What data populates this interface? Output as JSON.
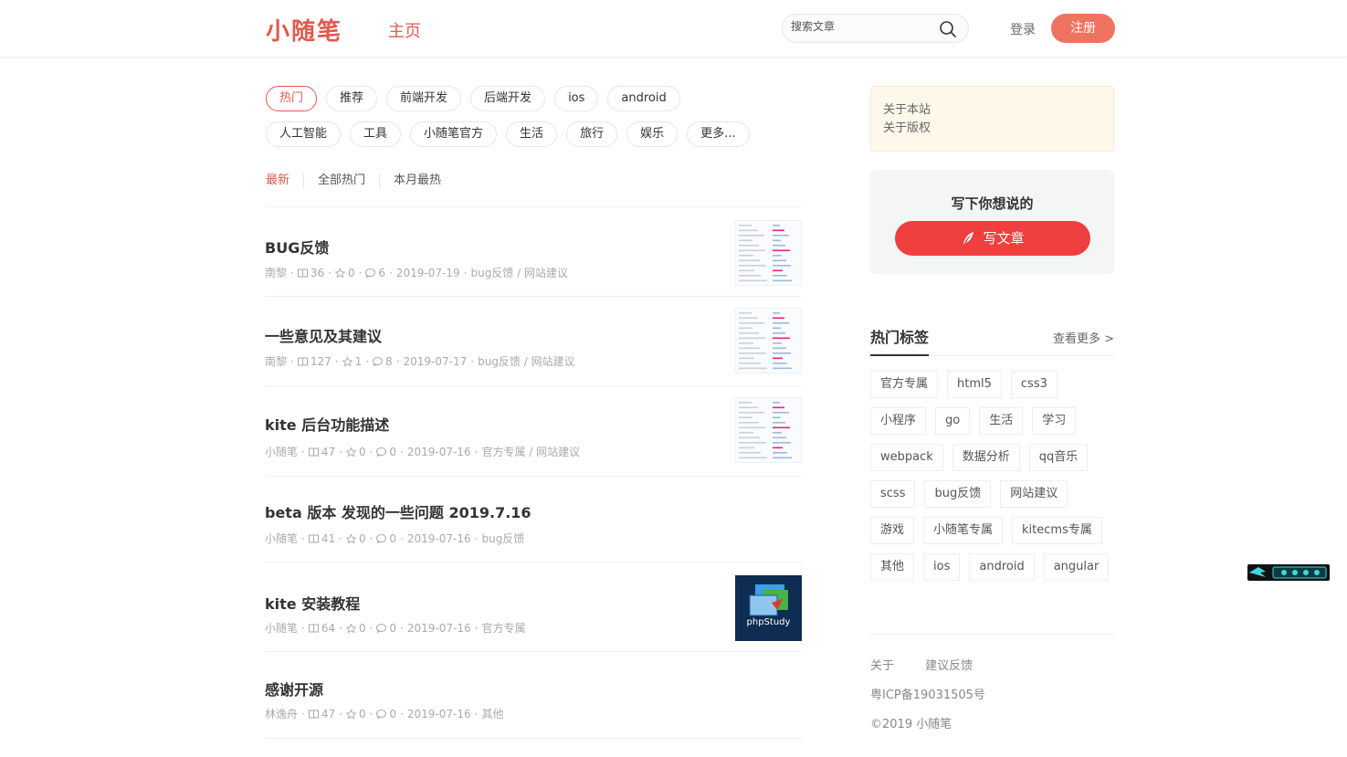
{
  "header": {
    "logo": "小随笔",
    "nav_home": "主页",
    "search_placeholder": "搜索文章",
    "login": "登录",
    "register": "注册"
  },
  "tags_row1": [
    "热门",
    "推荐",
    "前端开发",
    "后端开发",
    "ios",
    "android"
  ],
  "tags_row2": [
    "人工智能",
    "工具",
    "小随笔官方",
    "生活",
    "旅行",
    "娱乐",
    "更多..."
  ],
  "sort_tabs": [
    "最新",
    "全部热门",
    "本月最热"
  ],
  "articles": [
    {
      "title": "BUG反馈",
      "author": "南黎",
      "views": "36",
      "stars": "0",
      "comments": "6",
      "date": "2019-07-19",
      "tags": "bug反馈 / 网站建议",
      "thumb": "screenshot"
    },
    {
      "title": "一些意见及其建议",
      "author": "南黎",
      "views": "127",
      "stars": "1",
      "comments": "8",
      "date": "2019-07-17",
      "tags": "bug反馈 / 网站建议",
      "thumb": "screenshot"
    },
    {
      "title": "kite 后台功能描述",
      "author": "小随笔",
      "views": "47",
      "stars": "0",
      "comments": "0",
      "date": "2019-07-16",
      "tags": "官方专属 / 网站建议",
      "thumb": "screenshot"
    },
    {
      "title": "beta 版本 发现的一些问题 2019.7.16",
      "author": "小随笔",
      "views": "41",
      "stars": "0",
      "comments": "0",
      "date": "2019-07-16",
      "tags": "bug反馈",
      "thumb": ""
    },
    {
      "title": "kite 安装教程",
      "author": "小随笔",
      "views": "64",
      "stars": "0",
      "comments": "0",
      "date": "2019-07-16",
      "tags": "官方专属",
      "thumb": "phpstudy"
    },
    {
      "title": "感谢开源",
      "author": "林逸舟",
      "views": "47",
      "stars": "0",
      "comments": "0",
      "date": "2019-07-16",
      "tags": "其他",
      "thumb": ""
    }
  ],
  "thumb_phpstudy_label": "phpStudy",
  "sidebar": {
    "about_site": "关于本站",
    "about_copyright": "关于版权",
    "write_title": "写下你想说的",
    "write_button": "写文章",
    "hot_tags_title": "热门标签",
    "hot_tags_more": "查看更多 >",
    "hot_tags": [
      "官方专属",
      "html5",
      "css3",
      "小程序",
      "go",
      "生活",
      "学习",
      "webpack",
      "数据分析",
      "qq音乐",
      "scss",
      "bug反馈",
      "网站建议",
      "游戏",
      "小随笔专属",
      "kitecms专属",
      "其他",
      "ios",
      "android",
      "angular"
    ]
  },
  "footer": {
    "about": "关于",
    "feedback": "建议反馈",
    "icp": "粤ICP备19031505号",
    "copyright": "©2019 小随笔"
  },
  "colors": {
    "accent": "#e05a4f",
    "register_bg": "#f0735f",
    "write_btn_bg": "#ef3f3f"
  }
}
